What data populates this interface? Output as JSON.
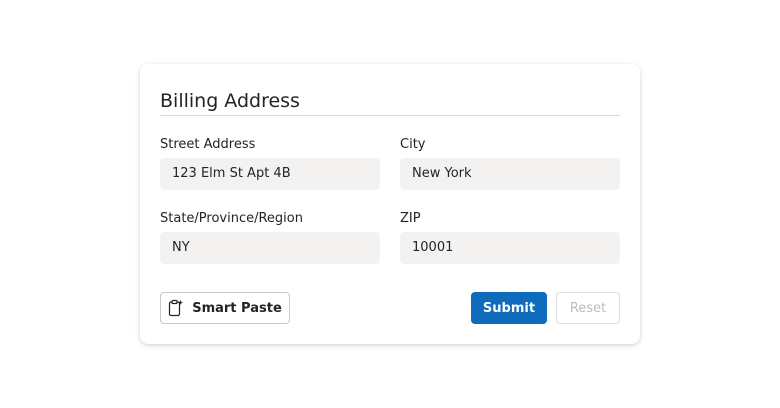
{
  "form": {
    "title": "Billing Address",
    "fields": {
      "street": {
        "label": "Street Address",
        "value": "123 Elm St Apt 4B"
      },
      "city": {
        "label": "City",
        "value": "New York"
      },
      "state": {
        "label": "State/Province/Region",
        "value": "NY"
      },
      "zip": {
        "label": "ZIP",
        "value": "10001"
      }
    },
    "buttons": {
      "smart_paste": "Smart Paste",
      "submit": "Submit",
      "reset": "Reset"
    },
    "icons": {
      "smart_paste": "clipboard-sparkle-icon"
    },
    "colors": {
      "primary": "#0f6cbd",
      "field_bg": "#f3f2f1",
      "disabled_text": "#bdbdbd"
    }
  }
}
